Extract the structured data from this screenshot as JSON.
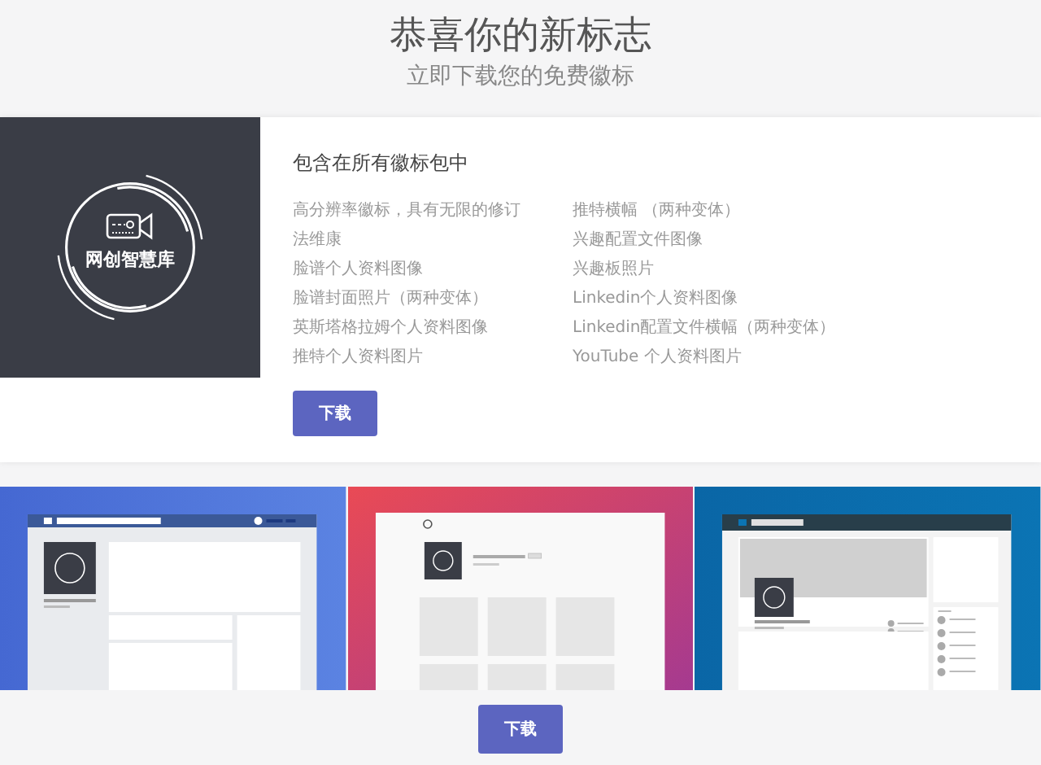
{
  "header": {
    "title": "恭喜你的新标志",
    "subtitle": "立即下载您的免费徽标"
  },
  "package": {
    "logo": {
      "name": "网创智慧库"
    },
    "heading": "包含在所有徽标包中",
    "columns": [
      [
        "高分辨率徽标，具有无限的修订",
        "法维康",
        "脸谱个人资料图像",
        "脸谱封面照片（两种变体）",
        "英斯塔格拉姆个人资料图像",
        "推特个人资料图片"
      ],
      [
        "推特横幅 （两种变体）",
        "兴趣配置文件图像",
        "兴趣板照片",
        "Linkedin个人资料图像",
        "Linkedin配置文件横幅（两种变体）",
        "YouTube 个人资料图片"
      ]
    ],
    "button": "下载"
  },
  "previews": [
    {
      "kind": "sidebar-profile"
    },
    {
      "kind": "photo-grid"
    },
    {
      "kind": "banner-profile"
    }
  ],
  "footer": {
    "button": "下载"
  }
}
